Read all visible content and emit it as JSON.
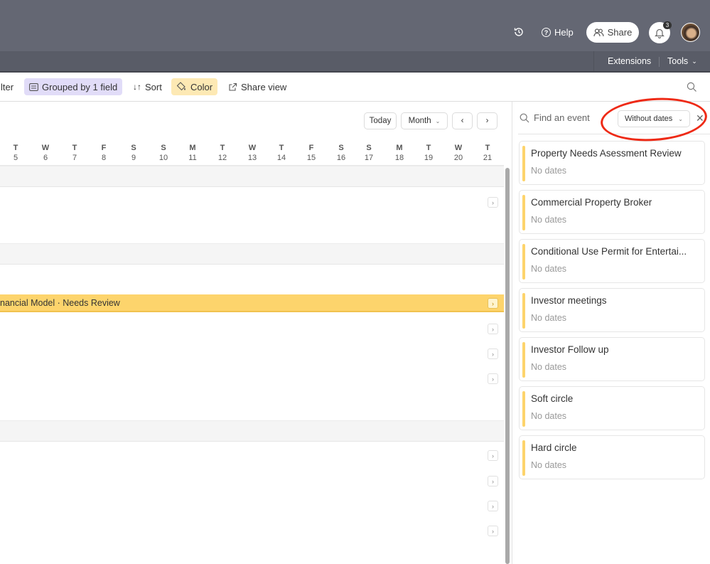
{
  "header": {
    "history_icon": "history-icon",
    "help_label": "Help",
    "share_label": "Share",
    "notification_count": "3",
    "extensions_label": "Extensions",
    "tools_label": "Tools"
  },
  "toolbar": {
    "filter_label": "lter",
    "grouped_label": "Grouped by 1 field",
    "sort_label": "Sort",
    "color_label": "Color",
    "share_view_label": "Share view"
  },
  "calendar": {
    "today_label": "Today",
    "view_select": "Month",
    "prev_icon": "‹",
    "next_icon": "›",
    "days": [
      {
        "dow": "T",
        "num": "5"
      },
      {
        "dow": "W",
        "num": "6"
      },
      {
        "dow": "T",
        "num": "7"
      },
      {
        "dow": "F",
        "num": "8"
      },
      {
        "dow": "S",
        "num": "9"
      },
      {
        "dow": "S",
        "num": "10"
      },
      {
        "dow": "M",
        "num": "11"
      },
      {
        "dow": "T",
        "num": "12"
      },
      {
        "dow": "W",
        "num": "13"
      },
      {
        "dow": "T",
        "num": "14"
      },
      {
        "dow": "F",
        "num": "15"
      },
      {
        "dow": "S",
        "num": "16"
      },
      {
        "dow": "S",
        "num": "17"
      },
      {
        "dow": "M",
        "num": "18"
      },
      {
        "dow": "T",
        "num": "19"
      },
      {
        "dow": "W",
        "num": "20"
      },
      {
        "dow": "T",
        "num": "21"
      }
    ],
    "event_bar_label": "nancial Model · Needs Review",
    "event_color": "#fdd46c"
  },
  "panel": {
    "search_placeholder": "Find an event",
    "filter_select": "Without dates",
    "events": [
      {
        "title": "Property Needs Asessment Review",
        "dates": "No dates"
      },
      {
        "title": "Commercial Property Broker",
        "dates": "No dates"
      },
      {
        "title": "Conditional Use Permit for Entertai...",
        "dates": "No dates"
      },
      {
        "title": "Investor meetings",
        "dates": "No dates"
      },
      {
        "title": "Investor Follow up",
        "dates": "No dates"
      },
      {
        "title": "Soft circle",
        "dates": "No dates"
      },
      {
        "title": "Hard circle",
        "dates": "No dates"
      }
    ],
    "annotation_color": "#ee2a16"
  }
}
